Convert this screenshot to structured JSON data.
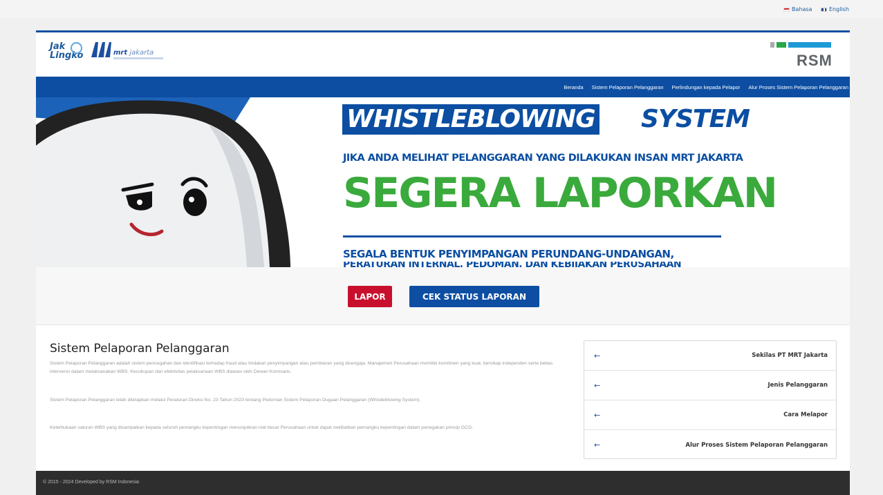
{
  "language": {
    "items": [
      {
        "label": "Bahasa",
        "flag": "flag-id-icon"
      },
      {
        "label": "English",
        "flag": "flag-en-icon"
      }
    ]
  },
  "header": {
    "logo_jaklingko_line1": "Jak",
    "logo_jaklingko_line2": "Lingko",
    "logo_mrt_text": "mrt",
    "logo_mrt_suffix": "jakarta",
    "logo_rsm": "RSM",
    "brand_blue": "#0d4ea2",
    "rsm_green": "#2aa745",
    "rsm_blue": "#1d9ad6"
  },
  "nav": {
    "items": [
      "Beranda",
      "Sistem Pelaporan Pelanggaran",
      "Perlindungan kepada Pelapor",
      "Alur Proses Sistem Pelaporan Pelanggaran"
    ]
  },
  "hero": {
    "headline_box": "WHISTLEBLOWING",
    "headline_tail": "SYSTEM",
    "sub1": "JIKA ANDA MELIHAT PELANGGARAN YANG DILAKUKAN INSAN MRT JAKARTA",
    "big": "SEGERA LAPORKAN",
    "sub2": "SEGALA BENTUK PENYIMPANGAN PERUNDANG-UNDANGAN,",
    "sub3": "PERATURAN INTERNAL, PEDOMAN, DAN KEBIJAKAN PERUSAHAAN"
  },
  "actions": {
    "lapor": "LAPOR",
    "cek_status": "CEK STATUS LAPORAN",
    "red": "#c8102e"
  },
  "content": {
    "title": "Sistem Pelaporan Pelanggaran",
    "p1": "Sistem Pelaporan Pelanggaran adalah sistem pencegahan dan identifikasi terhadap fraud atau tindakan penyimpangan atau pembiaran yang disengaja. Manajemen Perusahaan memiliki komitmen yang kuat, bersikap independen serta bebas intervensi dalam melaksanakan WBS. Kecukupan dan efektivitas pelaksanaan WBS diawasi oleh Dewan Komisaris.",
    "p2": "Sistem Pelaporan Pelanggaran telah ditetapkan melalui Peraturan Direksi No. 23 Tahun 2023 tentang Pedoman Sistem Pelaporan Dugaan Pelanggaran (Whistleblowing System).",
    "p3": "Keterbukaan saluran WBS yang disampaikan kepada seluruh pemangku kepentingan menunjukkan niat besar Perusahaan untuk dapat melibatkan pemangku kepentingan dalam penegakan prinsip GCG."
  },
  "side_panel": {
    "items": [
      "Sekilas PT MRT Jakarta",
      "Jenis Pelanggaran",
      "Cara Melapor",
      "Alur Proses Sistem Pelaporan Pelanggaran"
    ],
    "arrow_icon": "arrow-left-icon"
  },
  "footer": {
    "text": "© 2015 - 2024 Developed by RSM Indonesia"
  }
}
